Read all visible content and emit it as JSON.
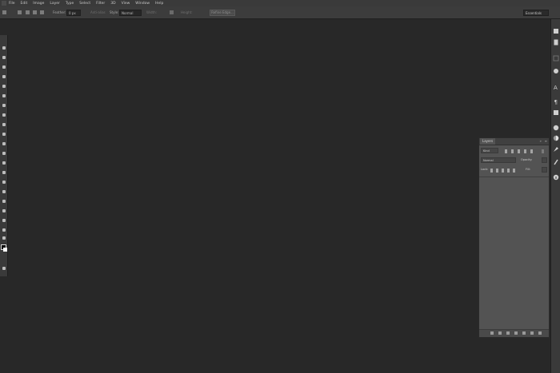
{
  "menubar": {
    "items": [
      "File",
      "Edit",
      "Image",
      "Layer",
      "Type",
      "Select",
      "Filter",
      "3D",
      "View",
      "Window",
      "Help"
    ]
  },
  "options": {
    "feather_label": "Feather:",
    "feather_value": "0 px",
    "antialias_label": "Anti-alias",
    "style_label": "Style:",
    "style_value": "Normal",
    "width_label": "Width:",
    "height_label": "Height:",
    "refine_edge_label": "Refine Edge...",
    "workspace_value": "Essentials"
  },
  "layers": {
    "tab_label": "Layers",
    "filter_value": "Kind",
    "blend_value": "Normal",
    "opacity_label": "Opacity:",
    "lock_label": "Lock:",
    "fill_label": "Fill:"
  },
  "colors": {
    "workspace_bg": "#282828",
    "chrome": "#3a3a3a",
    "panel": "#535353"
  }
}
